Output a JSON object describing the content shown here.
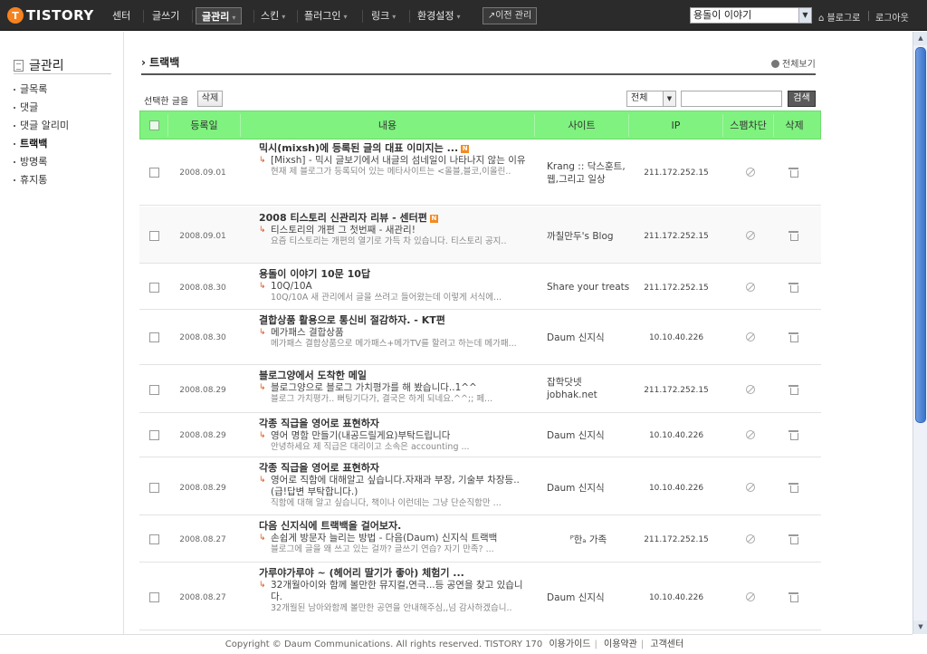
{
  "logo": {
    "badge": "T",
    "text": "TISTORY"
  },
  "nav": [
    {
      "label": "센터"
    },
    {
      "label": "글쓰기"
    },
    {
      "label": "글관리",
      "caret": "▾"
    },
    {
      "label": "스킨",
      "caret": "▾"
    },
    {
      "label": "플러그인",
      "caret": "▾"
    },
    {
      "label": "링크",
      "caret": "▾"
    },
    {
      "label": "환경설정",
      "caret": "▾"
    }
  ],
  "prev_manage": "이전 관리",
  "blog_select": "용돌이 이야기",
  "to_blog": "블로그로",
  "logout": "로그아웃",
  "sidebar": {
    "title": "글관리",
    "items": [
      "글목록",
      "댓글",
      "댓글 알리미",
      "트랙백",
      "방명록",
      "휴지통"
    ]
  },
  "main": {
    "title": "트랙백",
    "view_all": "전체보기",
    "selected_label": "선택한 글을",
    "delete_label": "삭제",
    "filter_value": "전체",
    "search_label": "검색"
  },
  "table": {
    "headers": [
      "등록일",
      "내용",
      "사이트",
      "IP",
      "스팸차단",
      "삭제"
    ],
    "rows": [
      {
        "date": "2008.09.01",
        "title": "믹시(mixsh)에 등록된 글의 대표 이미지는 ...",
        "new": true,
        "line": "[Mixsh] - 믹시 글보기에서 내글의 섬네일이 나타나지 않는 이유",
        "excerpt": "현재 제 블로그가 등록되어 있는 메타사이트는 <올블,블코,이올린..",
        "site": "Krang :: 닥스훈트,웹,그리고 일상",
        "ip": "211.172.252.15"
      },
      {
        "date": "2008.09.01",
        "title": "2008 티스토리 신관리자 리뷰 - 센터편",
        "new": true,
        "line": "티스토리의 개편 그 첫번째 - 새관리!",
        "excerpt": "요즘 티스토리는 개편의 열기로 가득 차 있습니다. 티스토리 공지..",
        "site": "까칠만두's Blog",
        "ip": "211.172.252.15"
      },
      {
        "date": "2008.08.30",
        "title": "용돌이 이야기 10문 10답",
        "new": false,
        "line": "10Q/10A",
        "excerpt": "10Q/10A 새 관리에서 글을 쓰려고 들어왔는데 이렇게 서식에...",
        "site": "Share your treats",
        "ip": "211.172.252.15"
      },
      {
        "date": "2008.08.30",
        "title": "결합상품 활용으로 통신비 절감하자. - KT편",
        "new": false,
        "line": "메가패스 결합상품",
        "excerpt": "메가패스 결합상품으로 메가패스+메가TV를 할려고 하는데 메가패...",
        "site": "Daum 신지식",
        "ip": "10.10.40.226"
      },
      {
        "date": "2008.08.29",
        "title": "블로그양에서 도착한 메일",
        "new": false,
        "line": "블로그양으로 블로그 가치평가를 해 봤습니다..1^^",
        "excerpt": "블로그 가치평가.. 뻐팅기다가, 결국은 하게 되네요.^^;; 페...",
        "site": "잡학닷넷 jobhak.net",
        "ip": "211.172.252.15"
      },
      {
        "date": "2008.08.29",
        "title": "각종 직급을 영어로 표현하자",
        "new": false,
        "line": "영어 명함 만들기(내공드릴게요)부탁드립니다",
        "excerpt": "안녕하세요 제 직급은 대리이고 소속은 accounting ...",
        "site": "Daum 신지식",
        "ip": "10.10.40.226"
      },
      {
        "date": "2008.08.29",
        "title": "각종 직급을 영어로 표현하자",
        "new": false,
        "line": "영어로 직함에 대해알고 싶습니다.자재과 부장, 기술부 차장등..(급!답변 부탁합니다.)",
        "excerpt": "직함에 대해 알고 싶습니다, 책이나 이런데는 그냥 단순직함만 ...",
        "site": "Daum 신지식",
        "ip": "10.10.40.226"
      },
      {
        "date": "2008.08.27",
        "title": "다음 신지식에 트랙백을 걸어보자.",
        "new": false,
        "line": "손쉽게 방문자 늘리는 방법 - 다음(Daum) 신지식 트랙백",
        "excerpt": "블로그에 글을 왜 쓰고 있는 걸까? 글쓰기 연습? 자기 만족? ...",
        "site": "ᴾ한ₐ 가족",
        "ip": "211.172.252.15"
      },
      {
        "date": "2008.08.27",
        "title": "가루야가루야 ~ (헤어리 딸기가 좋아) 체험기 ...",
        "new": false,
        "line": "32개월아이와 함께 볼만한 뮤지컬,연극...등 공연을 찾고 있습니다.",
        "excerpt": "32개월된 남아와함께 볼만한 공연을 안내해주심,,넘 감사하겠습니..",
        "site": "Daum 신지식",
        "ip": "10.10.40.226"
      }
    ]
  },
  "footer": {
    "copyright": "Copyright © Daum Communications. All rights reserved. TISTORY 170",
    "links": [
      "이용가이드",
      "이용약관",
      "고객센터"
    ]
  },
  "colors": {
    "highlight": "#7ff27f",
    "accent": "#f5821f",
    "topbar": "#2b2b2b"
  }
}
